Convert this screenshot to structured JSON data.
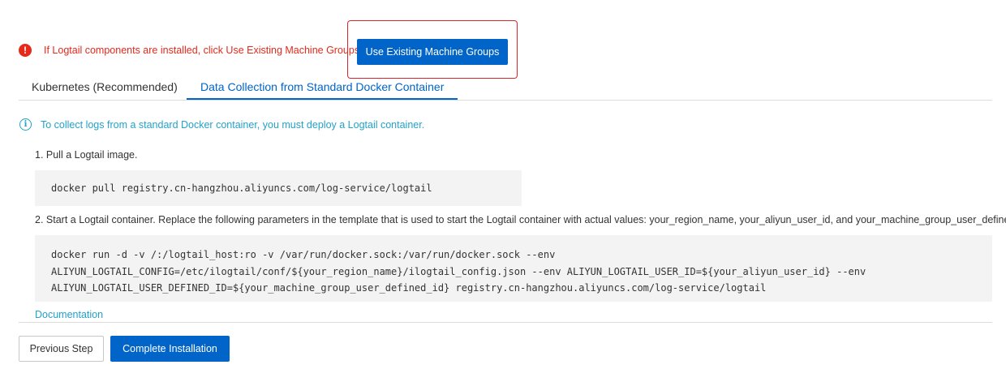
{
  "warning": {
    "icon": "exclamation-circle-icon",
    "color": "#e5291b",
    "text": "If Logtail components are installed, click Use Existing Machine Groups.",
    "button_label": "Use Existing Machine Groups"
  },
  "tabs": [
    {
      "label": "Kubernetes (Recommended)",
      "active": false
    },
    {
      "label": "Data Collection from Standard Docker Container",
      "active": true
    }
  ],
  "info": {
    "icon": "info-circle-icon",
    "text": "To collect logs from a standard Docker container, you must deploy a Logtail container."
  },
  "steps": [
    {
      "text": "1. Pull a Logtail image.",
      "code": [
        "docker pull registry.cn-hangzhou.aliyuncs.com/log-service/logtail"
      ]
    },
    {
      "text": "2. Start a Logtail container. Replace the following parameters in the template that is used to start the Logtail container with actual values: your_region_name, your_aliyun_user_id, and your_machine_group_user_defined_id.",
      "code": [
        "docker run -d -v /:/logtail_host:ro -v /var/run/docker.sock:/var/run/docker.sock --env",
        "ALIYUN_LOGTAIL_CONFIG=/etc/ilogtail/conf/${your_region_name}/ilogtail_config.json --env ALIYUN_LOGTAIL_USER_ID=${your_aliyun_user_id} --env",
        "ALIYUN_LOGTAIL_USER_DEFINED_ID=${your_machine_group_user_defined_id} registry.cn-hangzhou.aliyuncs.com/log-service/logtail"
      ]
    }
  ],
  "documentation_link": "Documentation",
  "footer": {
    "previous_label": "Previous Step",
    "complete_label": "Complete Installation"
  },
  "colors": {
    "primary": "#0064c8",
    "info": "#22a2c9",
    "error": "#e5291b"
  }
}
